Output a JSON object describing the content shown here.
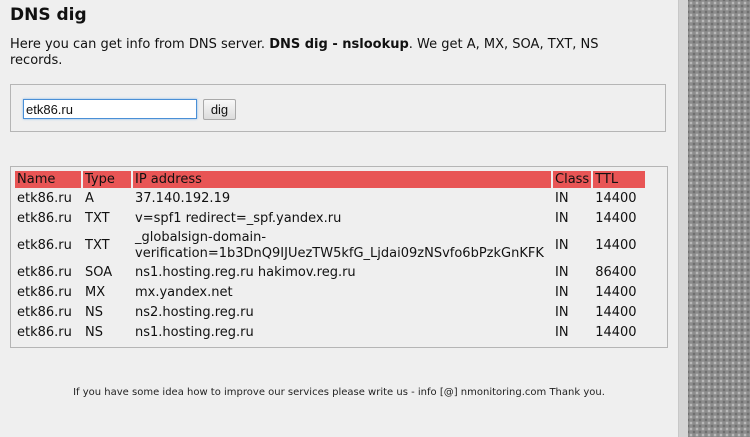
{
  "page": {
    "title": "DNS dig",
    "intro_prefix": "Here you can get info from DNS server. ",
    "intro_bold": "DNS dig - nslookup",
    "intro_suffix": ". We get A, MX, SOA, TXT, NS records."
  },
  "form": {
    "domain_value": "etk86.ru",
    "dig_label": "dig"
  },
  "table": {
    "headers": [
      "Name",
      "Type",
      "IP address",
      "Class",
      "TTL"
    ],
    "rows": [
      {
        "name": "etk86.ru",
        "type": "A",
        "ip": "37.140.192.19",
        "class": "IN",
        "ttl": "14400"
      },
      {
        "name": "etk86.ru",
        "type": "TXT",
        "ip": "v=spf1 redirect=_spf.yandex.ru",
        "class": "IN",
        "ttl": "14400"
      },
      {
        "name": "etk86.ru",
        "type": "TXT",
        "ip": "_globalsign-domain-\nverification=1b3DnQ9IJUezTW5kfG_Ljdai09zNSvfo6bPzkGnKFK",
        "class": "IN",
        "ttl": "14400"
      },
      {
        "name": "etk86.ru",
        "type": "SOA",
        "ip": "ns1.hosting.reg.ru hakimov.reg.ru",
        "class": "IN",
        "ttl": "86400"
      },
      {
        "name": "etk86.ru",
        "type": "MX",
        "ip": "mx.yandex.net",
        "class": "IN",
        "ttl": "14400"
      },
      {
        "name": "etk86.ru",
        "type": "NS",
        "ip": "ns2.hosting.reg.ru",
        "class": "IN",
        "ttl": "14400"
      },
      {
        "name": "etk86.ru",
        "type": "NS",
        "ip": "ns1.hosting.reg.ru",
        "class": "IN",
        "ttl": "14400"
      }
    ]
  },
  "footer": {
    "text": "If you have some idea how to improve our services please write us - info [@] nmonitoring.com Thank you."
  },
  "colors": {
    "header_row": "#e85555",
    "background": "#efefef"
  }
}
